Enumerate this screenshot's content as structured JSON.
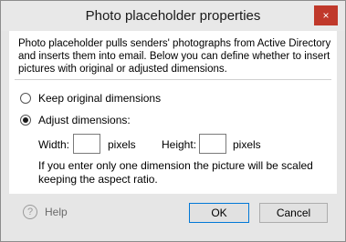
{
  "window": {
    "title": "Photo placeholder properties",
    "close_symbol": "×"
  },
  "intro_text": "Photo placeholder pulls senders' photographs from Active Directory and inserts them into email. Below you can define whether to insert pictures with original or adjusted dimensions.",
  "options": {
    "keep_label": "Keep original dimensions",
    "adjust_label": "Adjust dimensions:",
    "selected": "adjust"
  },
  "dimensions": {
    "width_label": "Width:",
    "width_value": "",
    "width_unit": "pixels",
    "height_label": "Height:",
    "height_value": "",
    "height_unit": "pixels"
  },
  "note": "If you enter only one dimension the picture will be scaled keeping the aspect ratio.",
  "footer": {
    "help_label": "Help",
    "help_symbol": "?",
    "ok_label": "OK",
    "cancel_label": "Cancel"
  },
  "colors": {
    "close_button": "#c0392b",
    "default_button_border": "#0078d7"
  }
}
